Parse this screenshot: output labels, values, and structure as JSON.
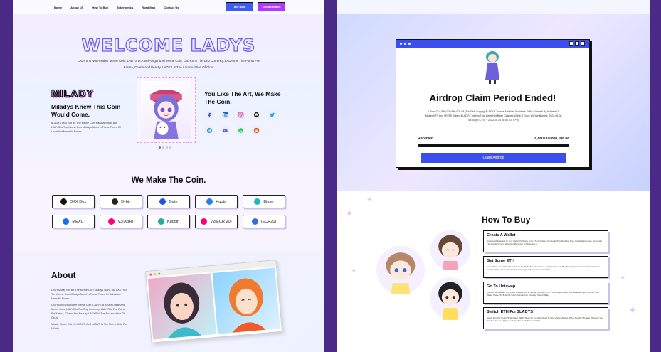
{
  "nav": {
    "links": [
      "Home",
      "About US",
      "How To Buy",
      "Tokenomics",
      "Road Map",
      "Contact Us"
    ],
    "buy_now": "Buy Now",
    "connect_wallet": "Connect Wallet"
  },
  "hero": {
    "welcome": "WELCOME LADYS",
    "description": "LADYS Is Not Another Meme Coin. LADYS Is A Self-Organized Meme Coin. LADYS Is The Drip Currency. LADYS Is The Points For Karma, Charm And Beauty. LADYS Is The Accumulation Of Clout",
    "logo": "MILADY",
    "coin_heading": "Miladys Knew This Coin Would Come.",
    "coin_body": "$LADYS May Not Be The Meme Coin Miladys Want, But LADYS Is The Meme Coin Miladys Need In These Times Of Unbridled Memetic Power.",
    "art_heading": "You Like The Art, We Make The Coin."
  },
  "socials": [
    "facebook-icon",
    "linkedin-icon",
    "instagram-icon",
    "github-icon",
    "twitter-icon",
    "telegram-icon",
    "discord-icon",
    "whatsapp-icon",
    "reddit-icon"
  ],
  "make_coin": {
    "title": "We Make The Coin.",
    "exchanges": [
      {
        "label": "OKX Dex",
        "icon": "okx-icon",
        "color": "#111111"
      },
      {
        "label": "Bybit",
        "icon": "bybit-icon",
        "color": "#222222"
      },
      {
        "label": "Gate",
        "icon": "gate-icon",
        "color": "#2354e6"
      },
      {
        "label": "Huobi",
        "icon": "huobi-icon",
        "color": "#2a7de1"
      },
      {
        "label": "Bitget",
        "icon": "bitget-icon",
        "color": "#1fb3c5"
      },
      {
        "label": "MEXC",
        "icon": "mexc-icon",
        "color": "#1b6ef3"
      },
      {
        "label": "V3(ABR)",
        "icon": "uniswap-icon",
        "color": "#ff007a"
      },
      {
        "label": "Kucoin",
        "icon": "kucoin-icon",
        "color": "#23af91"
      },
      {
        "label": "V2(ECR 20)",
        "icon": "uniswap-icon",
        "color": "#ff007a"
      },
      {
        "label": "(ECR20)",
        "icon": "layers-icon",
        "color": "#3a6bd6"
      }
    ]
  },
  "about": {
    "title": "About",
    "paragraphs": [
      "LADYS May Not Be The Meme Coin Miladys Want, But LADYS Is The Meme Coin Miladys Need In These Times Of Unbridled Memetic Power.",
      "LADYS Is Not Another Meme Coin. LADYS Is A Self-Organized Meme Coin. LADYS Is The Drip Currency. LADYS Is The Points For Karma, Charm And Beauty. LADYS Is The Accumulation Of Clout.",
      "Milady Meme Coin Is LADYS, And LADYS Is The Meme Coin For Milady."
    ]
  },
  "airdrop": {
    "title": "Airdrop Claim Period Ended!",
    "description": "A Total Of 8,880,000,880,008.88 (1% Total Supply) $LADYS Tokens Are Now Available To Be Claimed By Holders Of Milady NFT And $REMI Token. $LADYS Tokens That Have Not Been Claimed Within 7 Days Will Be Burned. 2023.05.08 08:00 (UTC+0) ~ 2023.05.15 08:00 (UTC+0)",
    "received_label": "Received",
    "received_value": "8,880,000,880,008.88",
    "progress_fraction": 1.0,
    "claim_button": "Claim Airdrop"
  },
  "how_to_buy": {
    "title": "How To Buy",
    "steps": [
      {
        "title": "Create A Wallet",
        "body": "Download Metamask Or Your Wallet Of Choice From The App Store Or Google Play Store For Free. For Desktop Users, Download The Google Chrome Extension By Going To Metamask.io."
      },
      {
        "title": "Get Some ETH",
        "body": "Have ETH In Your Wallet To Switch To $LADYS. If You Don't Have Any ETH, You Can Buy Directly On Metamask, Transfer From Another Wallet, Or Buy On Another Exchange And Send It To Your Wallet."
      },
      {
        "title": "Go To Uniswap",
        "body": "Connect To Uniswap. Go To App.Uniswap.Org In Google Chrome Or On The Browser Inside Your Metamask App. Connect Your Wallet. Paste The $LADYS Token Address Into Uniswap, Select Milady."
      },
      {
        "title": "Switch ETH For $LADYS",
        "body": "Switch ETH For $LADYS. We Have ZERO Taxes So You Don't Need To Worry About Buying With A Specific Slippage, Although You May Need To Use Slippage During Times Of Market Volatility."
      }
    ]
  }
}
